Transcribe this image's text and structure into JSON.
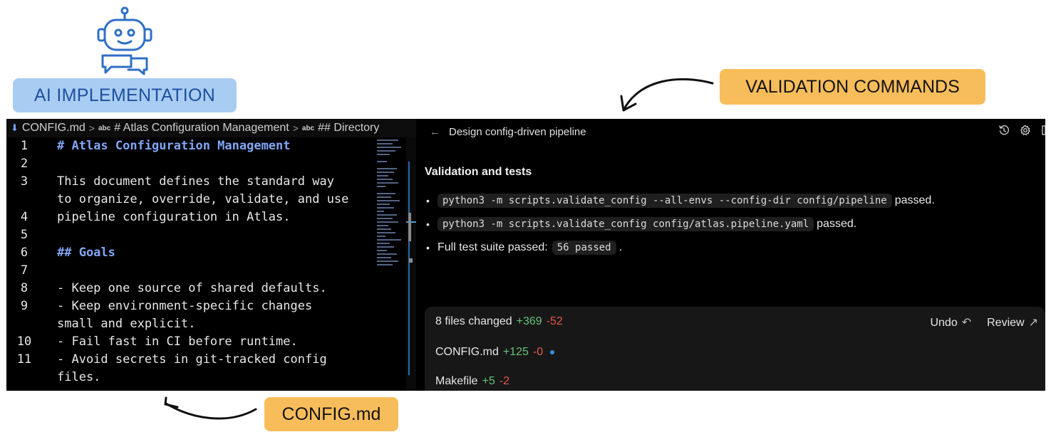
{
  "labels": {
    "ai": "AI IMPLEMENTATION",
    "validation": "VALIDATION COMMANDS",
    "config": "CONFIG.md"
  },
  "icons": {
    "robot": "robot-chat-icon",
    "file": "markdown-file-icon",
    "history": "history-icon",
    "settings": "gear-icon",
    "undo": "undo-icon",
    "review": "arrow-up-right-icon"
  },
  "colors": {
    "blue_label": "#a9cdf2",
    "orange_label": "#f8bd5b",
    "added": "#67c27a",
    "removed": "#e5574f",
    "heading_code": "#82a6f5"
  },
  "editor": {
    "breadcrumb": {
      "file": "CONFIG.md",
      "abc": "abc",
      "section1": "# Atlas Configuration Management",
      "section2": "## Directory"
    },
    "lines": [
      {
        "n": "1",
        "text": "# Atlas Configuration Management",
        "heading": true
      },
      {
        "n": "2",
        "text": "",
        "heading": false
      },
      {
        "n": "3",
        "text": "This document defines the standard way",
        "heading": false
      },
      {
        "n": "",
        "text": "to organize, override, validate, and use",
        "heading": false
      },
      {
        "n": "4",
        "text": "pipeline configuration in Atlas.",
        "heading": false
      },
      {
        "n": "5",
        "text": "",
        "heading": false
      },
      {
        "n": "6",
        "text": "## Goals",
        "heading": true
      },
      {
        "n": "7",
        "text": "",
        "heading": false
      },
      {
        "n": "8",
        "text": "- Keep one source of shared defaults.",
        "heading": false
      },
      {
        "n": "9",
        "text": "- Keep environment-specific changes",
        "heading": false
      },
      {
        "n": "",
        "text": "small and explicit.",
        "heading": false
      },
      {
        "n": "10",
        "text": "- Fail fast in CI before runtime.",
        "heading": false
      },
      {
        "n": "11",
        "text": "- Avoid secrets in git-tracked config",
        "heading": false
      },
      {
        "n": "",
        "text": "files.",
        "heading": false
      }
    ]
  },
  "chat": {
    "back_arrow": "←",
    "title": "Design config-driven pipeline",
    "section_title": "Validation and tests",
    "bullets": [
      {
        "code": "python3 -m scripts.validate_config --all-envs --config-dir config/pipeline",
        "suffix": "passed.",
        "prefix": ""
      },
      {
        "code": "python3 -m scripts.validate_config config/atlas.pipeline.yaml",
        "suffix": "passed.",
        "prefix": ""
      },
      {
        "prefix": "Full test suite passed:",
        "code": "56 passed",
        "suffix": "."
      }
    ],
    "card": {
      "summary": "8 files changed",
      "added": "+369",
      "removed": "-52",
      "undo": "Undo",
      "review": "Review",
      "files": [
        {
          "name": "CONFIG.md",
          "added": "+125",
          "removed": "-0"
        },
        {
          "name": "Makefile",
          "added": "+5",
          "removed": "-2"
        }
      ]
    }
  }
}
